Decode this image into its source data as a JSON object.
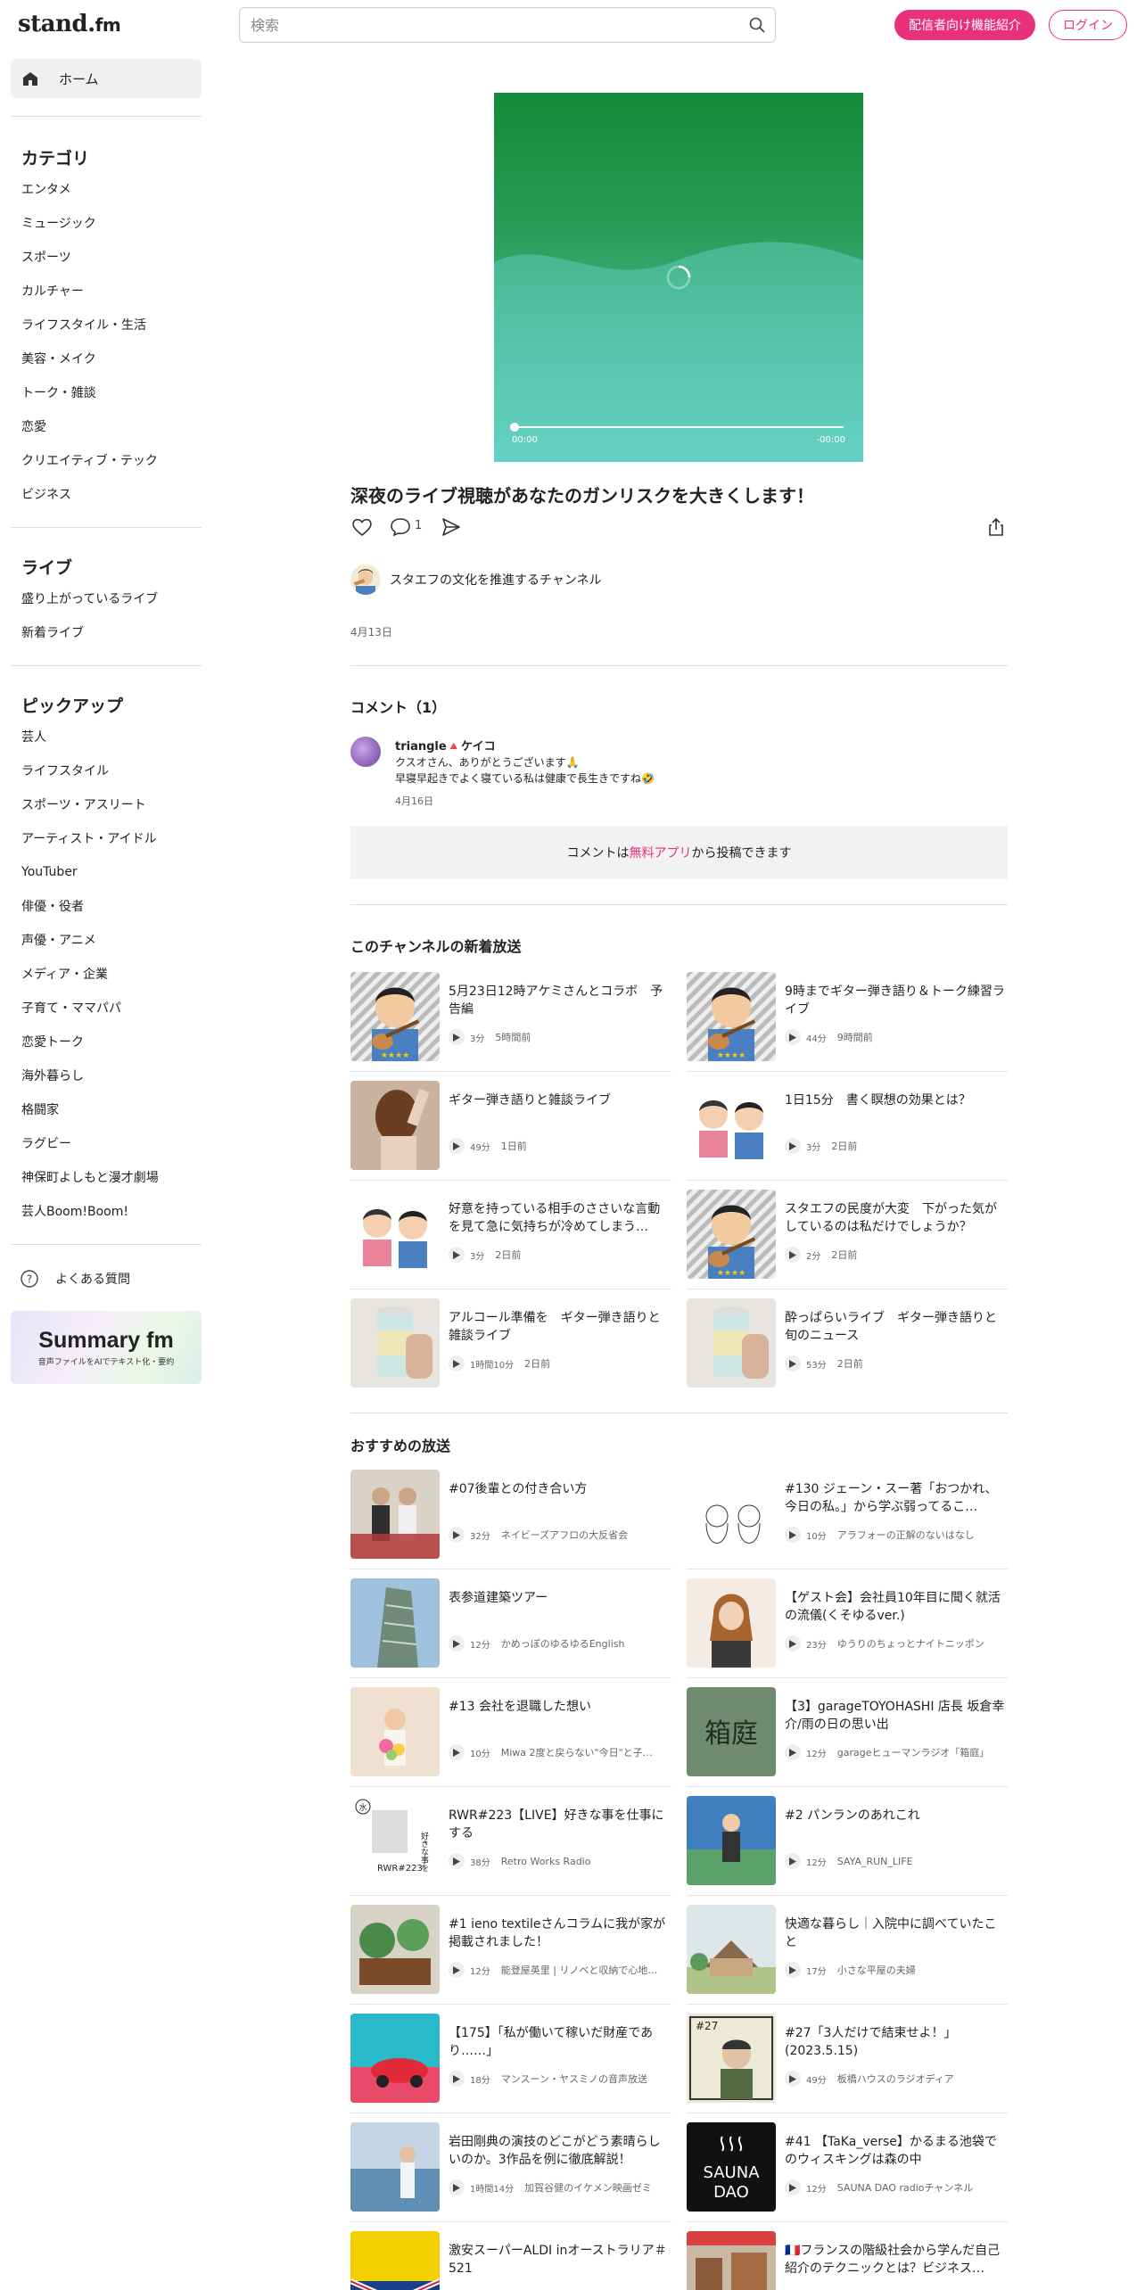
{
  "header": {
    "logo_main": "stand.",
    "logo_fm": "fm",
    "search_placeholder": "検索",
    "broadcaster_button": "配信者向け機能紹介",
    "login_button": "ログイン"
  },
  "sidebar": {
    "home": "ホーム",
    "categories_title": "カテゴリ",
    "categories": [
      "エンタメ",
      "ミュージック",
      "スポーツ",
      "カルチャー",
      "ライフスタイル・生活",
      "美容・メイク",
      "トーク・雑談",
      "恋愛",
      "クリエイティブ・テック",
      "ビジネス"
    ],
    "live_title": "ライブ",
    "live": [
      "盛り上がっているライブ",
      "新着ライブ"
    ],
    "pickup_title": "ピックアップ",
    "pickup": [
      "芸人",
      "ライフスタイル",
      "スポーツ・アスリート",
      "アーティスト・アイドル",
      "YouTuber",
      "俳優・役者",
      "声優・アニメ",
      "メディア・企業",
      "子育て・ママパパ",
      "恋愛トーク",
      "海外暮らし",
      "格闘家",
      "ラグビー",
      "神保町よしもと漫才劇場",
      "芸人Boom!Boom!"
    ],
    "faq": "よくある質問",
    "banner_title": "Summary fm",
    "banner_sub": "音声ファイルをAIでテキスト化・要約"
  },
  "player": {
    "current_time": "00:00",
    "remaining_time": "-00:00",
    "progress": 0
  },
  "episode": {
    "title": "深夜のライブ視聴があなたのガンリスクを大きくします！",
    "comment_count": "1",
    "channel_name": "スタエフの文化を推進するチャンネル",
    "date": "4月13日"
  },
  "comments": {
    "title": "コメント（1）",
    "items": [
      {
        "name": "triangle🔺ケイコ",
        "line1": "クスオさん、ありがとうございます🙏",
        "line2": "早寝早起きでよく寝ている私は健康で長生きですね🤣",
        "date": "4月16日"
      }
    ],
    "post_prefix": "コメントは",
    "post_link": "無料アプリ",
    "post_suffix": "から投稿できます"
  },
  "new_section": {
    "title": "このチャンネルの新着放送",
    "items": [
      {
        "title": "5月23日12時アケミさんとコラボ　予告編",
        "duration": "3分",
        "time": "5時間前",
        "thumb": "guitar-man"
      },
      {
        "title": "9時までギター弾き語り＆トーク練習ライブ",
        "duration": "44分",
        "time": "9時間前",
        "thumb": "guitar-man"
      },
      {
        "title": "ギター弾き語りと雑談ライブ",
        "duration": "49分",
        "time": "1日前",
        "thumb": "woman-back"
      },
      {
        "title": "1日15分　書く瞑想の効果とは？",
        "duration": "3分",
        "time": "2日前",
        "thumb": "couple"
      },
      {
        "title": "好意を持っている相手のささいな言動を見て急に気持ちが冷めてしまう…",
        "duration": "3分",
        "time": "2日前",
        "thumb": "couple"
      },
      {
        "title": "スタエフの民度が大変　下がった気がしているのは私だけでしょうか？",
        "duration": "2分",
        "time": "2日前",
        "thumb": "guitar-man"
      },
      {
        "title": "アルコール準備を　ギター弾き語りと雑談ライブ",
        "duration": "1時間10分",
        "time": "2日前",
        "thumb": "can"
      },
      {
        "title": "酔っぱらいライブ　ギター弾き語りと旬のニュース",
        "duration": "53分",
        "time": "2日前",
        "thumb": "can"
      }
    ]
  },
  "recommend_section": {
    "title": "おすすめの放送",
    "items": [
      {
        "title": "#07後輩との付き合い方",
        "duration": "32分",
        "channel": "ネイビーズアフロの大反省会",
        "thumb": "photo1"
      },
      {
        "title": "#130 ジェーン・スー著「おつかれ、今日の私。」から学ぶ弱ってるこ…",
        "duration": "10分",
        "channel": "アラフォーの正解のないはなし",
        "thumb": "sketch"
      },
      {
        "title": "表参道建築ツアー",
        "duration": "12分",
        "channel": "かめっぽのゆるゆるEnglish",
        "thumb": "building"
      },
      {
        "title": "【ゲスト会】会社員10年目に聞く就活の流儀(くそゆるver.)",
        "duration": "23分",
        "channel": "ゆうりのちょっとナイトニッポン",
        "thumb": "woman"
      },
      {
        "title": "#13 会社を退職した想い",
        "duration": "10分",
        "channel": "Miwa 2度と戻らない\"今日\"と子…",
        "thumb": "flowers"
      },
      {
        "title": "【3】garageTOYOHASHI 店長 坂倉幸介/雨の日の思い出",
        "duration": "12分",
        "channel": "garageヒューマンラジオ「箱庭」",
        "thumb": "hakoniwa"
      },
      {
        "title": "RWR#223【LIVE】好きな事を仕事にする",
        "duration": "38分",
        "channel": "Retro Works Radio",
        "thumb": "rwr"
      },
      {
        "title": "#2 パンランのあれこれ",
        "duration": "12分",
        "channel": "SAYA_RUN_LIFE",
        "thumb": "runner"
      },
      {
        "title": "#1 ieno textileさんコラムに我が家が掲載されました！",
        "duration": "12分",
        "channel": "能登屋英里 | リノベと収納で心地…",
        "thumb": "plants"
      },
      {
        "title": "快適な暮らし｜入院中に調べていたこと",
        "duration": "17分",
        "channel": "小さな平屋の夫婦",
        "thumb": "house"
      },
      {
        "title": "【175】「私が働いて稼いだ財産であり……」",
        "duration": "18分",
        "channel": "マンスーン・ヤスミノの音声放送",
        "thumb": "car"
      },
      {
        "title": "#27「3人だけで結束せよ！」(2023.5.15)",
        "duration": "49分",
        "channel": "板橋ハウスのラジオディア",
        "thumb": "man27"
      },
      {
        "title": "岩田剛典の演技のどこがどう素晴らしいのか。3作品を例に徹底解説！",
        "duration": "1時間14分",
        "channel": "加賀谷健のイケメン映画ゼミ",
        "thumb": "sea"
      },
      {
        "title": "#41 【TaKa_verse】かるまる池袋でのウィスキングは森の中",
        "duration": "12分",
        "channel": "SAUNA DAO radioチャンネル",
        "thumb": "sauna"
      },
      {
        "title": "激安スーパーALDI inオーストラリア＃521",
        "duration": "",
        "channel": "",
        "thumb": "aldi"
      },
      {
        "title": "🇫🇷フランスの階級社会から学んだ自己紹介のテクニックとは？ビジネス…",
        "duration": "",
        "channel": "",
        "thumb": "france"
      }
    ]
  },
  "colors": {
    "accent": "#e8317a",
    "player_top": "#148a3a",
    "player_bottom": "#6fd9d3"
  }
}
